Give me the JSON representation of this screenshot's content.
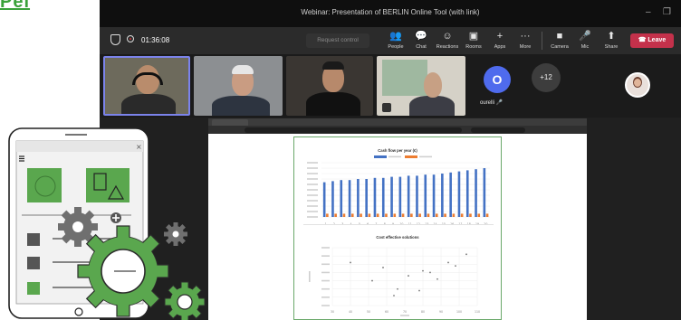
{
  "top_link": {
    "text": "Pel"
  },
  "window": {
    "title": "Webinar: Presentation of BERLIN Online Tool (with link)",
    "minimize": "–",
    "maximize": "❐"
  },
  "toolbar": {
    "timer": "01:36:08",
    "request_control": "Request control",
    "items": [
      {
        "label": "People",
        "icon": "people-icon",
        "glyph": "👥"
      },
      {
        "label": "Chat",
        "icon": "chat-icon",
        "glyph": "💬"
      },
      {
        "label": "Reactions",
        "icon": "reactions-icon",
        "glyph": "☺"
      },
      {
        "label": "Rooms",
        "icon": "rooms-icon",
        "glyph": "▣"
      },
      {
        "label": "Apps",
        "icon": "apps-icon",
        "glyph": "+"
      },
      {
        "label": "More",
        "icon": "more-icon",
        "glyph": "···"
      },
      {
        "label": "Camera",
        "icon": "camera-icon",
        "glyph": "■"
      },
      {
        "label": "Mic",
        "icon": "mic-icon",
        "glyph": "🎤"
      },
      {
        "label": "Share",
        "icon": "share-icon",
        "glyph": "⬆"
      }
    ],
    "leave": "Leave"
  },
  "participants": {
    "avatar_initial": "O",
    "avatar_name": "ourelli",
    "overflow": "+12"
  },
  "shared_doc": {
    "chart1_title": "Cash flow per year (€)",
    "chart2_title": "Cost effective solutions"
  },
  "chart_data": [
    {
      "type": "bar",
      "title": "Cash flow per year (€)",
      "categories": [
        "1",
        "2",
        "3",
        "4",
        "5",
        "6",
        "7",
        "8",
        "9",
        "10",
        "11",
        "12",
        "13",
        "14",
        "15",
        "16",
        "17",
        "18",
        "19",
        "20"
      ],
      "series": [
        {
          "values": [
            32000,
            33000,
            34000,
            34000,
            35000,
            35000,
            36000,
            36000,
            37000,
            37000,
            38000,
            38000,
            39000,
            39000,
            40000,
            41000,
            42000,
            43000,
            44000,
            45000
          ]
        },
        {
          "values": [
            3000,
            3000,
            3000,
            3000,
            3000,
            3000,
            3000,
            3000,
            3000,
            3000,
            3000,
            3000,
            3000,
            3000,
            3000,
            3000,
            3000,
            3000,
            3000,
            3000
          ]
        }
      ],
      "colors": [
        "#4472c4",
        "#ed7d31"
      ],
      "ylim": [
        0,
        50000
      ]
    },
    {
      "type": "scatter",
      "title": "Cost effective solutions",
      "points": [
        [
          40,
          52000
        ],
        [
          52,
          30000
        ],
        [
          58,
          46000
        ],
        [
          64,
          12000
        ],
        [
          66,
          20000
        ],
        [
          72,
          36000
        ],
        [
          78,
          18000
        ],
        [
          80,
          42000
        ],
        [
          84,
          40000
        ],
        [
          88,
          32000
        ],
        [
          94,
          52000
        ],
        [
          98,
          48000
        ],
        [
          104,
          62000
        ]
      ],
      "xlim": [
        30,
        110
      ],
      "ylim": [
        0,
        70000
      ]
    }
  ],
  "colors": {
    "teams_bg": "#1f1f1f",
    "leave": "#c4314b",
    "accent_green": "#5aa74e"
  }
}
